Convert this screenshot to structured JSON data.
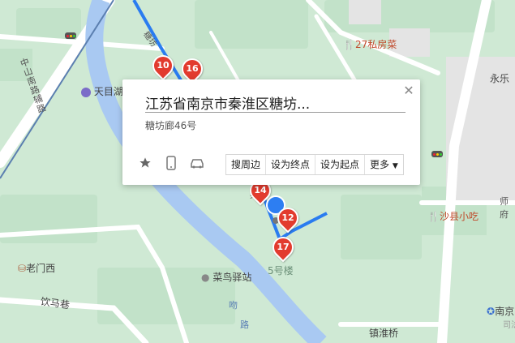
{
  "popup": {
    "title": "江苏省南京市秦淮区糖坊...",
    "address": "糖坊廊46号",
    "buttons": [
      "搜周边",
      "设为终点",
      "设为起点",
      "更多"
    ]
  },
  "map_labels": {
    "road_zhongshan_south": "中山南路辅路",
    "restaurant_27": "27私房菜",
    "tianmu": "天目湖",
    "yongle": "永乐",
    "shaxian": "沙县小吃",
    "laomenxi": "老门西",
    "yinmaxiang": "饮马巷",
    "cainiao": "菜鸟驿站",
    "building5": "5号楼",
    "zhenhuaiqiao": "镇淮桥",
    "nanjing": "南京",
    "nanjing2": "司法",
    "shifu_road": "师\n府",
    "road_fragment": "吻",
    "road_fragment2": "路",
    "small_text": "糖坊",
    "small_text2": "樂"
  },
  "markers": [
    "10",
    "16",
    "14",
    "12",
    "17"
  ]
}
